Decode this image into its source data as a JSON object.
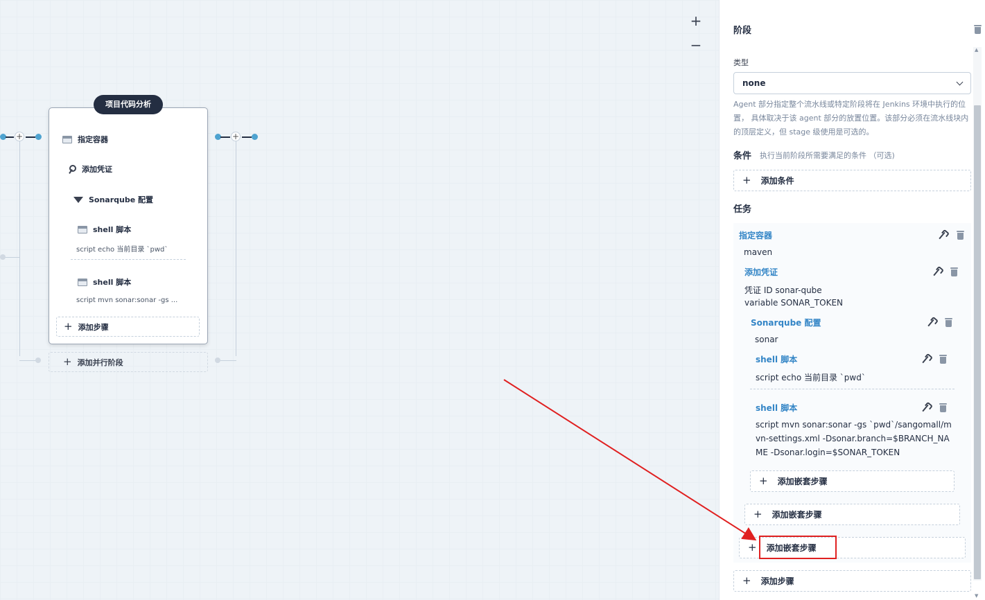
{
  "canvas": {
    "zoom_in": "+",
    "zoom_out": "−",
    "stage": {
      "title": "项目代码分析",
      "steps": [
        {
          "label": "指定容器",
          "icon": "container-icon"
        },
        {
          "label": "添加凭证",
          "icon": "key-icon"
        },
        {
          "label": "Sonarqube 配置",
          "icon": "sonar-icon"
        },
        {
          "label": "shell 脚本",
          "icon": "terminal-icon",
          "sub": "script   echo 当前目录 `pwd`"
        },
        {
          "label": "shell 脚本",
          "icon": "terminal-icon",
          "sub": "script   mvn sonar:sonar -gs ..."
        }
      ],
      "add_step": "添加步骤"
    },
    "add_parallel": "添加并行阶段",
    "connector_plus": "+"
  },
  "panel": {
    "title": "阶段",
    "type_label": "类型",
    "type_value": "none",
    "agent_desc": "Agent 部分指定整个流水线或特定阶段将在 Jenkins 环境中执行的位置， 具体取决于该 agent 部分的放置位置。该部分必须在流水线块内的顶层定义，但 stage 级使用是可选的。",
    "conditions_title": "条件",
    "conditions_note": "执行当前阶段所需要满足的条件 （可选)",
    "add_condition": "添加条件",
    "tasks_title": "任务",
    "tasks": {
      "container": {
        "label": "指定容器",
        "value": "maven"
      },
      "credential": {
        "label": "添加凭证",
        "id_line": "凭证 ID   sonar-qube",
        "var_line": "variable   SONAR_TOKEN"
      },
      "sonar": {
        "label": "Sonarqube 配置",
        "value": "sonar"
      },
      "shell1": {
        "label": "shell 脚本",
        "value": "script   echo 当前目录 `pwd`"
      },
      "shell2": {
        "label": "shell 脚本",
        "value": "script   mvn sonar:sonar -gs `pwd`/sangomall/mvn-settings.xml -Dsonar.branch=$BRANCH_NAME -Dsonar.login=$SONAR_TOKEN"
      },
      "add_nested_1": "添加嵌套步骤",
      "add_nested_2": "添加嵌套步骤",
      "add_nested_3": "添加嵌套步骤"
    },
    "add_step": "添加步骤"
  },
  "colors": {
    "accent": "#3385c6",
    "highlight": "#e02020",
    "dark": "#242e42"
  }
}
